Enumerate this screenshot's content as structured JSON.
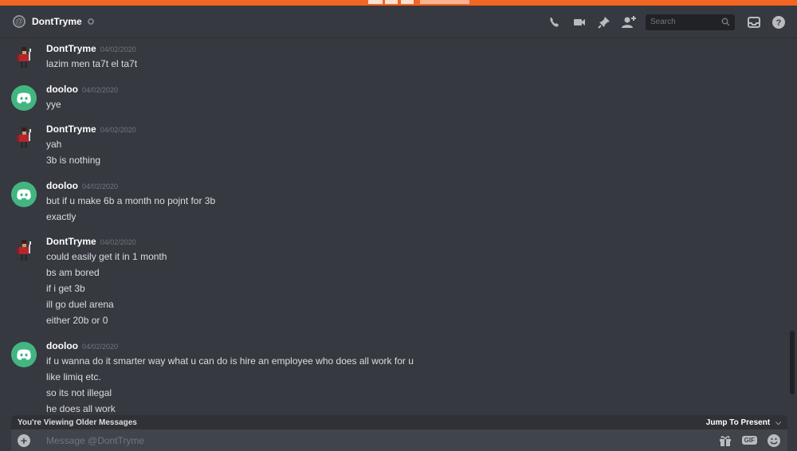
{
  "header": {
    "username": "DontTryme",
    "search_placeholder": "Search"
  },
  "groups": [
    {
      "author": "DontTryme",
      "avatar": "pixel-character-avatar",
      "timestamp": "04/02/2020",
      "lines": [
        "lazim men ta7t el ta7t"
      ]
    },
    {
      "author": "dooloo",
      "avatar": "discord-logo-avatar",
      "timestamp": "04/02/2020",
      "lines": [
        "yye"
      ]
    },
    {
      "author": "DontTryme",
      "avatar": "pixel-character-avatar",
      "timestamp": "04/02/2020",
      "lines": [
        "yah",
        "3b is nothing"
      ]
    },
    {
      "author": "dooloo",
      "avatar": "discord-logo-avatar",
      "timestamp": "04/02/2020",
      "lines": [
        "but if u make 6b a month no pojnt for 3b",
        "exactly"
      ]
    },
    {
      "author": "DontTryme",
      "avatar": "pixel-character-avatar",
      "timestamp": "04/02/2020",
      "lines": [
        "could easily get it in 1 month",
        "bs am bored",
        "if i get 3b",
        "ill go duel arena",
        "either 20b or 0"
      ]
    },
    {
      "author": "dooloo",
      "avatar": "discord-logo-avatar",
      "timestamp": "04/02/2020",
      "lines": [
        "if u wanna do it smarter way what u can do is hire an employee who does all work for u",
        "like limiq etc.",
        "so its not illegal",
        "he does all work"
      ]
    }
  ],
  "older_bar": {
    "label": "You're Viewing Older Messages",
    "jump_label": "Jump To Present"
  },
  "composer": {
    "placeholder": "Message @DontTryme",
    "gif_label": "GIF"
  },
  "colors": {
    "background": "#36393f",
    "accent_top": "#f26522",
    "discord_green": "#43b581",
    "composer_bg": "#40444b"
  }
}
